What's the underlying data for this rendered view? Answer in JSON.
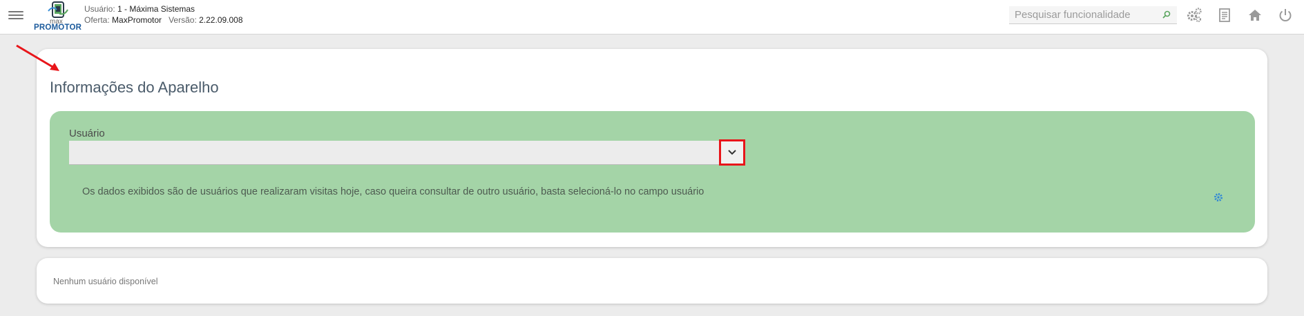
{
  "header": {
    "logo": {
      "line1": "max",
      "line2": "PROMOTOR"
    },
    "user_label": "Usuário:",
    "user_value": "1 - Máxima Sistemas",
    "offer_label": "Oferta:",
    "offer_value": "MaxPromotor",
    "version_label": "Versão:",
    "version_value": "2.22.09.008",
    "search_placeholder": "Pesquisar funcionalidade",
    "icons": [
      "menu-icon",
      "search-icon",
      "settings-icon",
      "document-icon",
      "home-icon",
      "power-icon"
    ]
  },
  "page": {
    "title": "Informações do Aparelho",
    "user_field_label": "Usuário",
    "user_field_value": "",
    "info_text": "Os dados exibidos são de usuários que realizaram visitas hoje, caso queira consultar de outro usuário, basta selecioná-lo no campo usuário",
    "empty_message": "Nenhum usuário disponível"
  },
  "colors": {
    "green_panel": "#a4d4a7",
    "brand_blue": "#1c5b9c",
    "annotation_red": "#e8151a"
  }
}
